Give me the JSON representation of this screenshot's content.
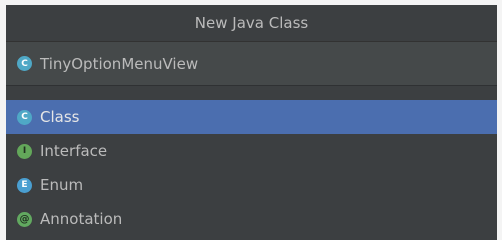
{
  "dialog": {
    "title": "New Java Class"
  },
  "name_field": {
    "value": "TinyOptionMenuView",
    "icon": "class-icon",
    "icon_glyph": "C"
  },
  "kinds": [
    {
      "label": "Class",
      "icon": "class-icon",
      "glyph": "C",
      "selected": true
    },
    {
      "label": "Interface",
      "icon": "interface-icon",
      "glyph": "I",
      "selected": false
    },
    {
      "label": "Enum",
      "icon": "enum-icon",
      "glyph": "E",
      "selected": false
    },
    {
      "label": "Annotation",
      "icon": "annotation-icon",
      "glyph": "@",
      "selected": false
    }
  ],
  "colors": {
    "background": "#3c3f41",
    "selection": "#4b6eaf",
    "text": "#bbbbbb"
  }
}
